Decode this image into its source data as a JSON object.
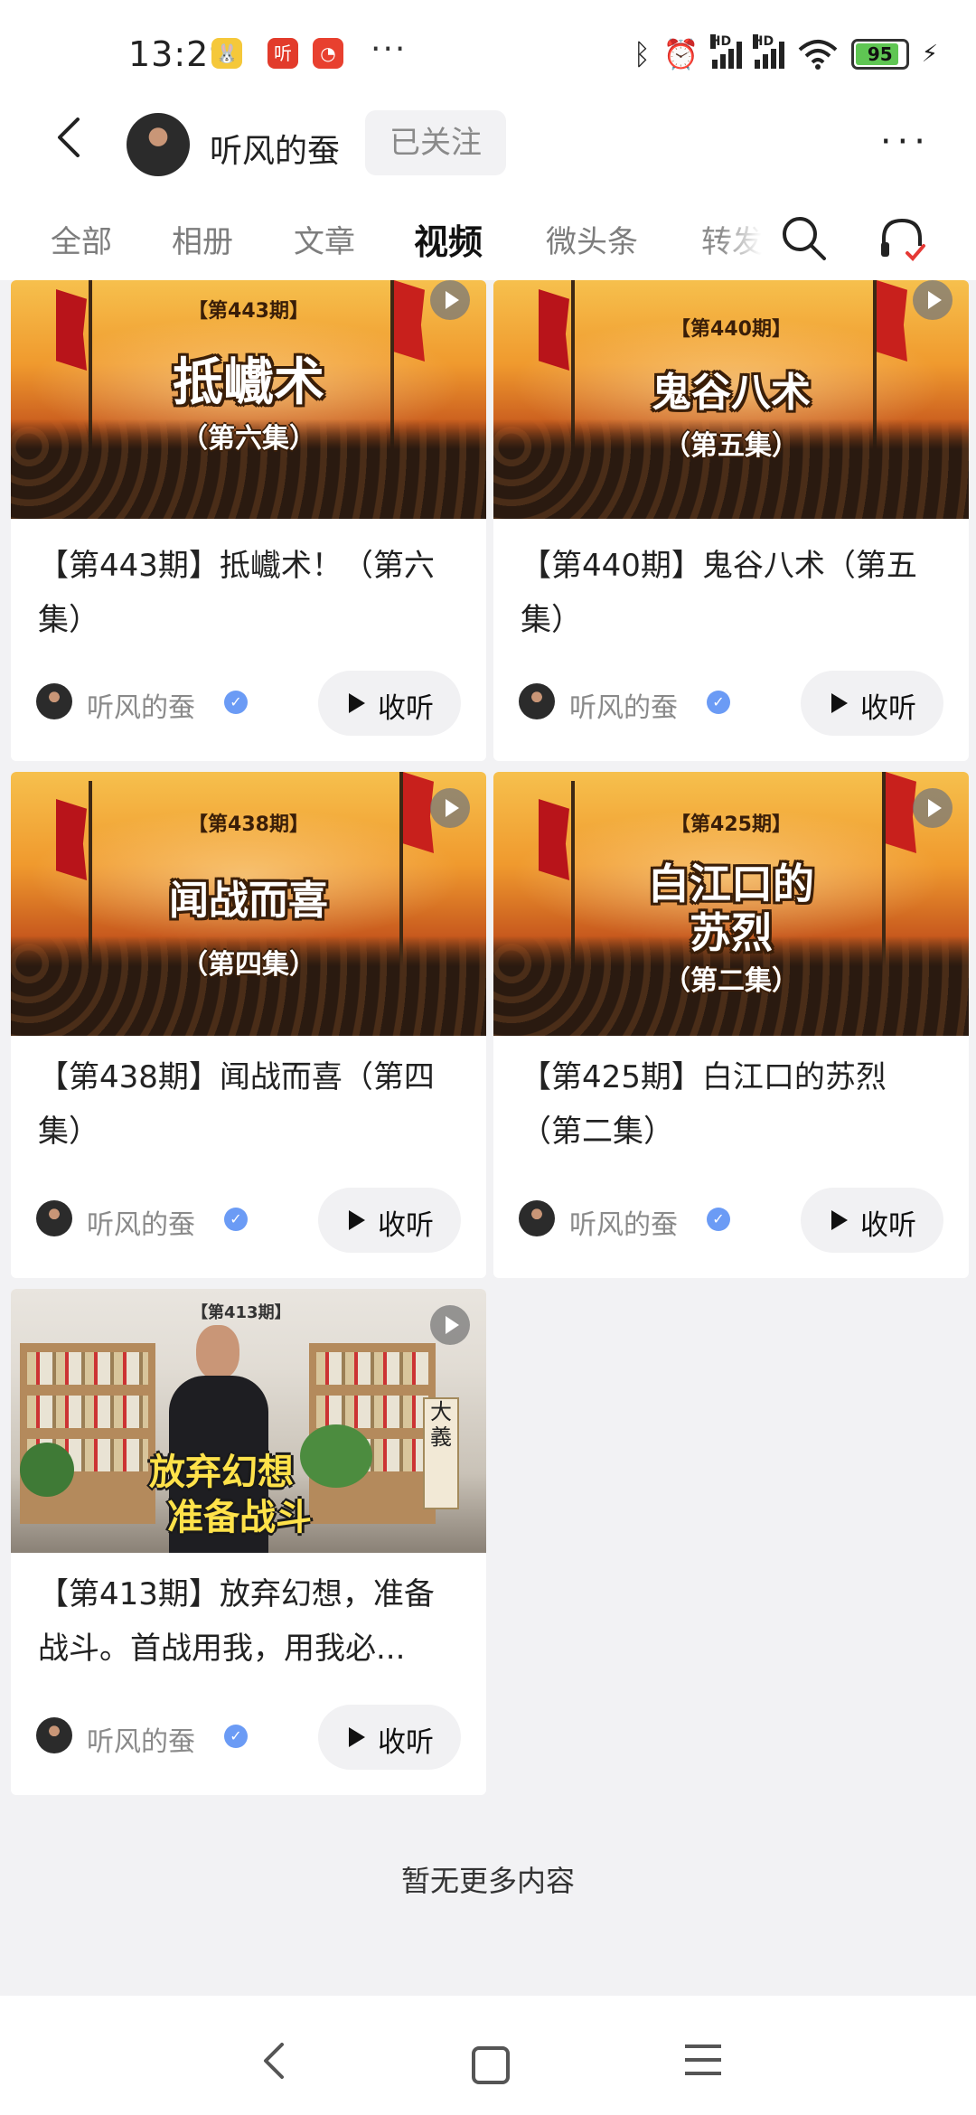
{
  "status_bar": {
    "time": "13:29",
    "more": "···",
    "battery": "95",
    "signal_label": "HD"
  },
  "header": {
    "author_name": "听风的蚕",
    "follow_label": "已关注",
    "more_label": "···"
  },
  "tabs": [
    {
      "label": "全部"
    },
    {
      "label": "相册"
    },
    {
      "label": "文章"
    },
    {
      "label": "视频"
    },
    {
      "label": "微头条"
    },
    {
      "label": "转发"
    }
  ],
  "active_tab": "视频",
  "videos": [
    {
      "title": "【第443期】抵巇术！（第六集）",
      "thumb_episode": "【第443期】",
      "thumb_title": "抵巇术",
      "thumb_sub": "（第六集）",
      "author": "听风的蚕",
      "listen_label": "收听"
    },
    {
      "title": "【第440期】鬼谷八术（第五集）",
      "thumb_episode": "【第440期】",
      "thumb_title": "鬼谷八术",
      "thumb_sub": "（第五集）",
      "author": "听风的蚕",
      "listen_label": "收听"
    },
    {
      "title": "【第438期】闻战而喜（第四集）",
      "thumb_episode": "【第438期】",
      "thumb_title": "闻战而喜",
      "thumb_sub": "（第四集）",
      "author": "听风的蚕",
      "listen_label": "收听"
    },
    {
      "title": "【第425期】白江口的苏烈（第二集）",
      "thumb_episode": "【第425期】",
      "thumb_title": "白江口的",
      "thumb_title2": "苏烈",
      "thumb_sub": "（第二集）",
      "author": "听风的蚕",
      "listen_label": "收听"
    },
    {
      "title": "【第413期】放弃幻想，准备战斗。首战用我，用我必...",
      "thumb_episode": "【第413期】",
      "thumb_title": "放弃幻想",
      "thumb_title2": "准备战斗",
      "thumb_callig": "大義",
      "author": "听风的蚕",
      "listen_label": "收听"
    }
  ],
  "footer": {
    "no_more": "暂无更多内容"
  },
  "icons": {
    "verified": "verified-icon",
    "play": "play-icon",
    "search": "search-icon",
    "headset": "headset-icon"
  },
  "colors": {
    "verified_blue": "#6b9bf5",
    "flag_red": "#b8141a",
    "battery_green": "#5fc653"
  }
}
